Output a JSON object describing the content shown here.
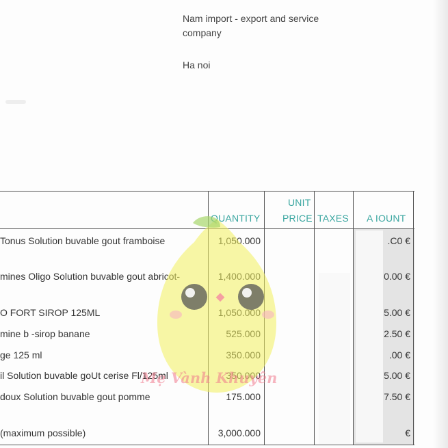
{
  "address": {
    "line1": "Nam import - export and service",
    "line2": "company",
    "city": "Ha noi"
  },
  "table": {
    "headers": {
      "quantity": "QUANTITY",
      "unit": "UNIT",
      "price": "PRICE",
      "taxes": "TAXES",
      "amount": "A  IOUNT"
    },
    "rows": [
      {
        "description": "Tonus Solution buvable gout framboise",
        "quantity": "1,050.000",
        "amount": ".C0 €"
      },
      {
        "description": "mines Oligo Solution buvable gout abricot-",
        "quantity": "1,400.000",
        "amount": "0.00 €"
      },
      {
        "description": "O FORT SIROP 125ML",
        "quantity": "1,050.000",
        "amount": "5.00 €"
      },
      {
        "description": "mine b -sirop banane",
        "quantity": "525.000",
        "amount": "2.50 €"
      },
      {
        "description": "ge 125 ml",
        "quantity": "350.000",
        "amount": ".00 €"
      },
      {
        "description": "il Solution buvable goUt cerise Fl/125ml",
        "quantity": "350.000",
        "amount": "5.00 €"
      },
      {
        "description": "doux Solution buvable gout pomme",
        "quantity": "175.000",
        "amount": "7.50 €"
      },
      {
        "description": "(maximum possible)",
        "quantity": "3,000.000",
        "amount": "€"
      }
    ]
  },
  "watermark": {
    "text": "Mẹ Vành Khuyên",
    "color": "#f0788c"
  }
}
